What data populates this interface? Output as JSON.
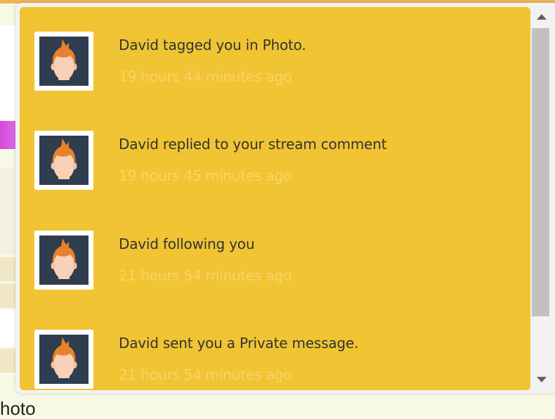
{
  "background": {
    "caption_text": "hoto"
  },
  "notifications": [
    {
      "message": "David tagged you in Photo.",
      "time": "19 hours 44 minutes ago",
      "avatar": "user-avatar-icon"
    },
    {
      "message": "David replied to your stream comment",
      "time": "19 hours 45 minutes ago",
      "avatar": "user-avatar-icon"
    },
    {
      "message": "David following you",
      "time": "21 hours 54 minutes ago",
      "avatar": "user-avatar-icon"
    },
    {
      "message": "David sent you a Private message.",
      "time": "21 hours 54 minutes ago",
      "avatar": "user-avatar-icon"
    }
  ],
  "colors": {
    "list_background": "#f0c433",
    "message_text": "#333333",
    "time_text": "#f7d46a",
    "avatar_background": "#2f3d4f",
    "avatar_hair": "#e8822a",
    "avatar_face": "#f7d2b8",
    "scrollbar_thumb": "#c1c1c1"
  }
}
